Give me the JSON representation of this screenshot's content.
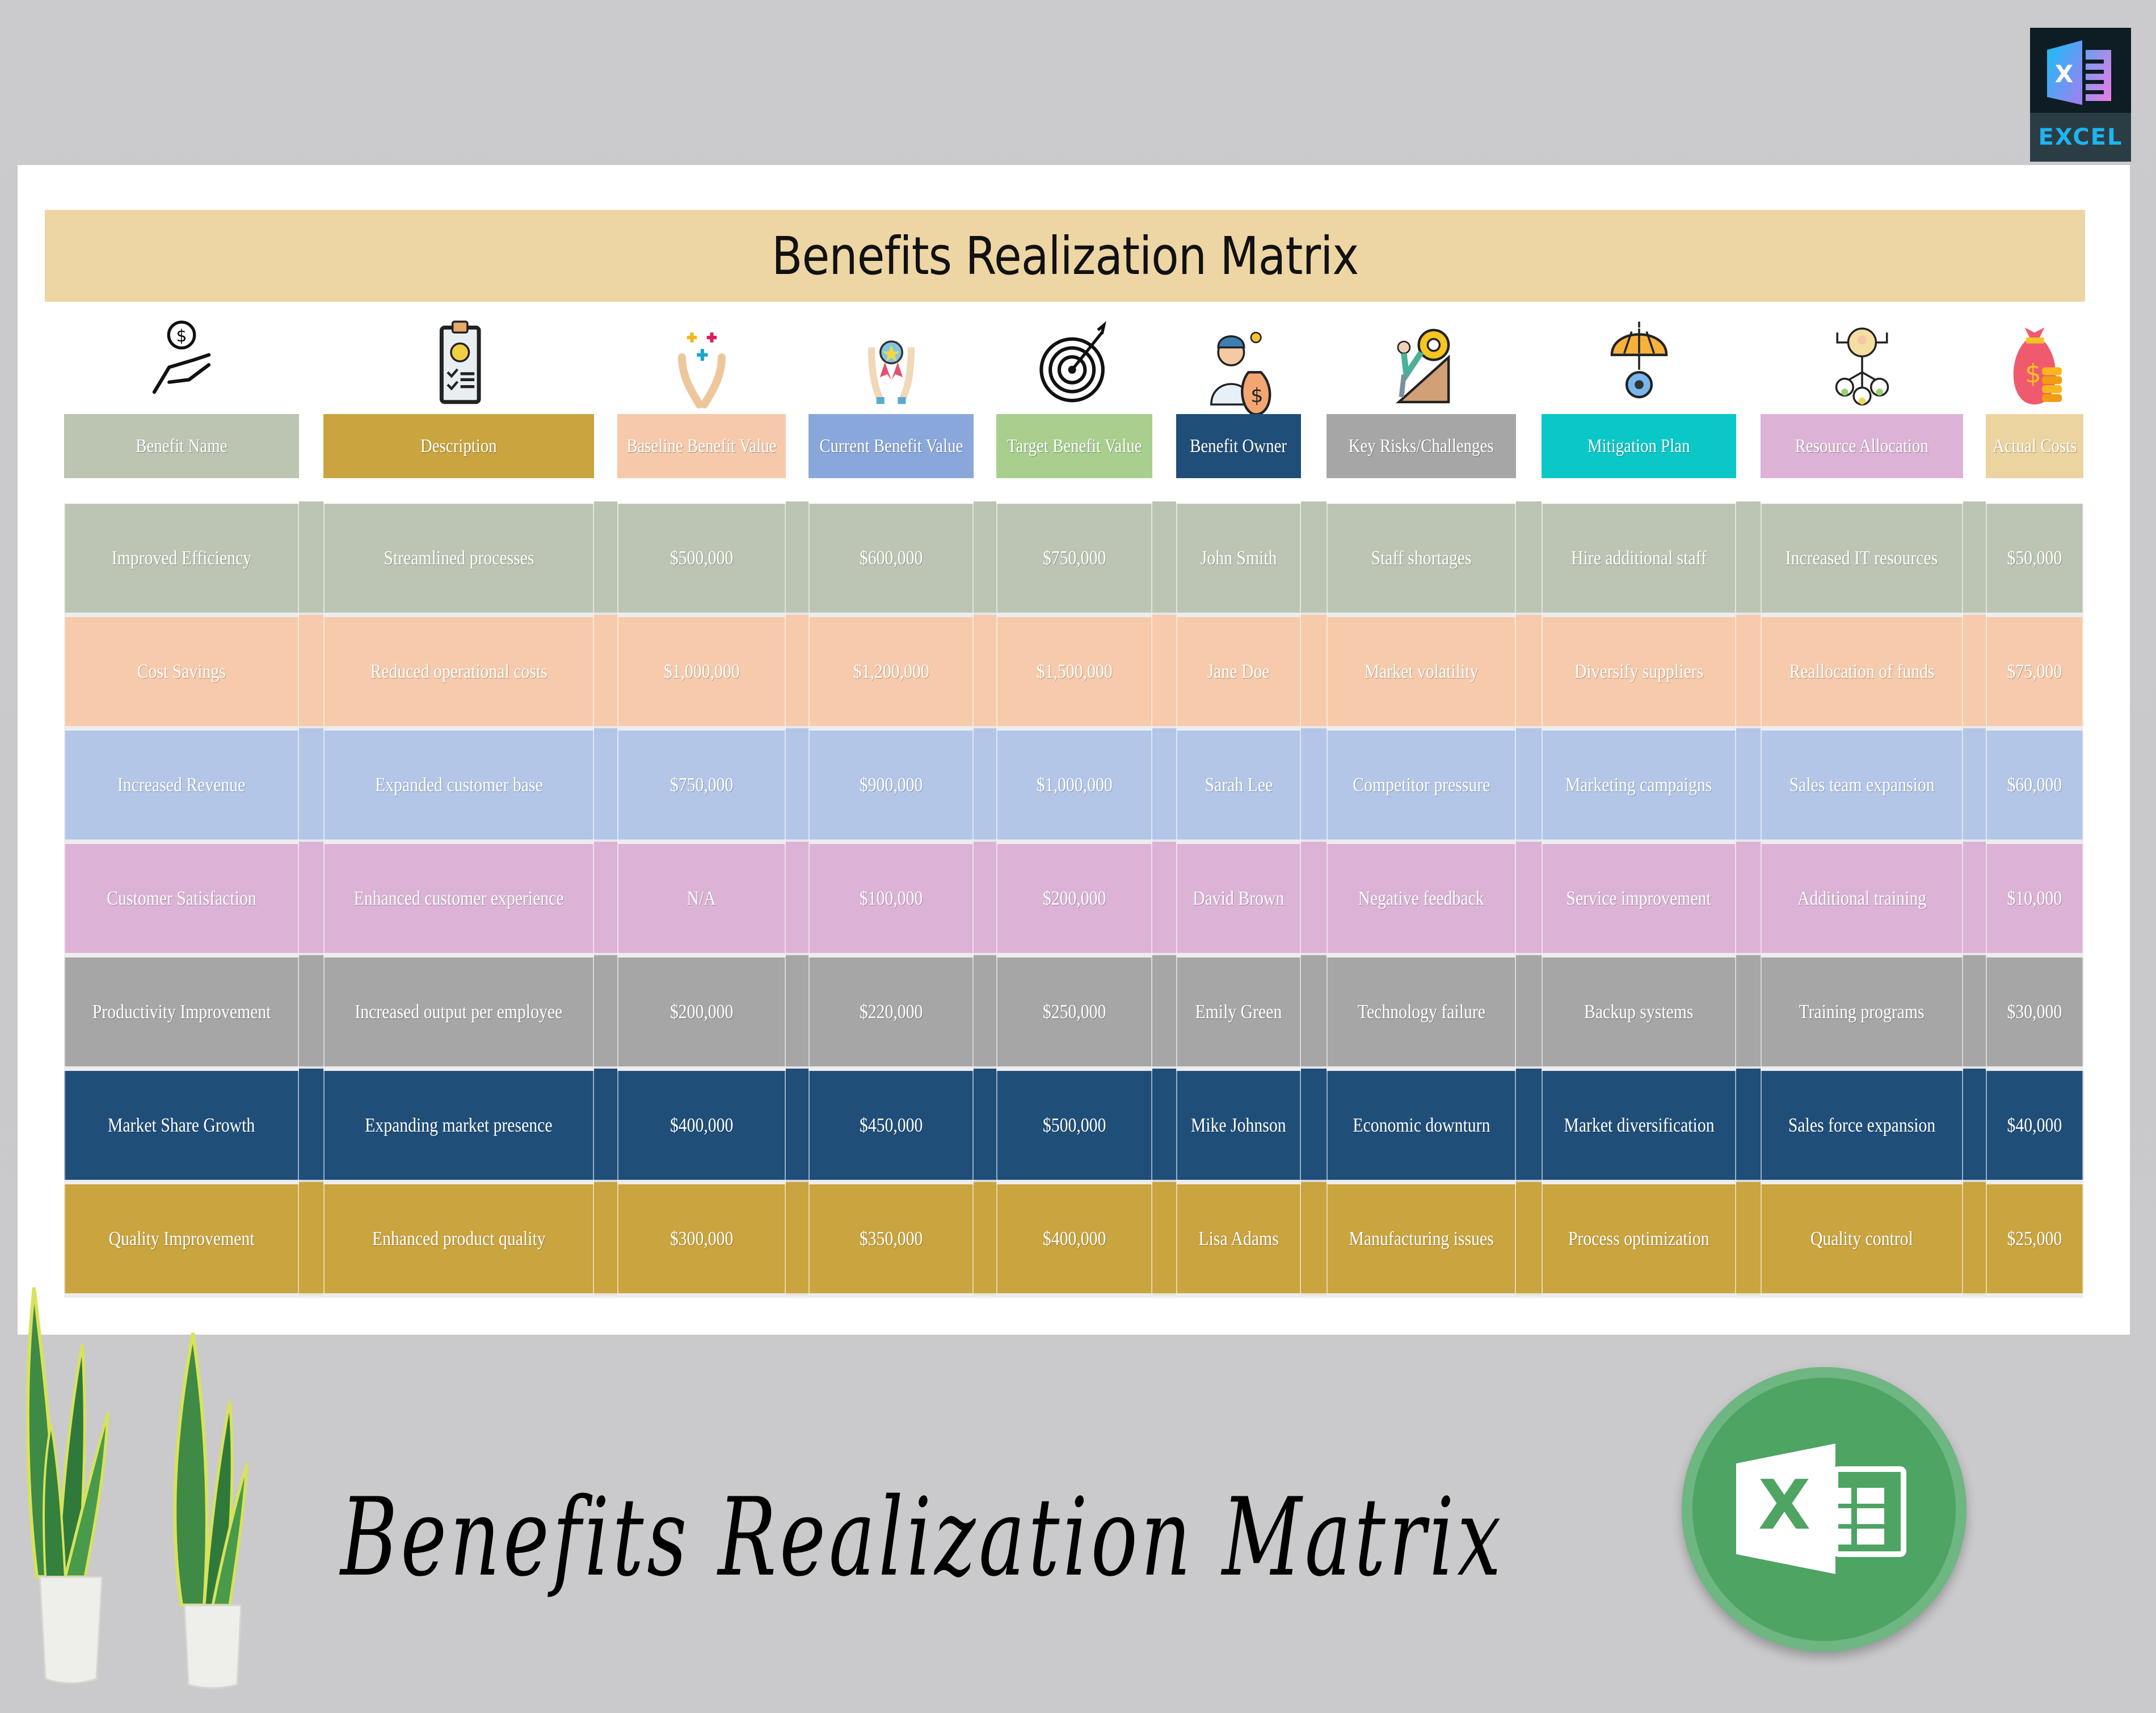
{
  "badge": {
    "label": "EXCEL",
    "icon": "excel-logo-icon",
    "accent": "#1eb4f0"
  },
  "title": "Benefits Realization Matrix",
  "columns": [
    {
      "label": "Benefit Name",
      "icon": "hand-coin-icon",
      "color": "#bcc4b2"
    },
    {
      "label": "Description",
      "icon": "clipboard-checklist-icon",
      "color": "#c9a43f"
    },
    {
      "label": "Baseline Benefit Value",
      "icon": "hands-plus-icon",
      "color": "#f6c9aa"
    },
    {
      "label": "Current Benefit Value",
      "icon": "award-hands-icon",
      "color": "#8aa7db"
    },
    {
      "label": "Target Benefit Value",
      "icon": "target-arrow-icon",
      "color": "#a8cf8e"
    },
    {
      "label": "Benefit Owner",
      "icon": "owner-money-bag-icon",
      "color": "#1f4e79"
    },
    {
      "label": "Key Risks/Challenges",
      "icon": "climber-gear-icon",
      "color": "#a6a6a6"
    },
    {
      "label": "Mitigation Plan",
      "icon": "umbrella-gear-icon",
      "color": "#0ac8c8"
    },
    {
      "label": "Resource Allocation",
      "icon": "team-network-icon",
      "color": "#dcb3d6"
    },
    {
      "label": "Actual Costs",
      "icon": "money-bag-coins-icon",
      "color": "#ecd4a0"
    }
  ],
  "rows": [
    {
      "color": "#bcc5b3",
      "cells": [
        "Improved Efficiency",
        "Streamlined processes",
        "$500,000",
        "$600,000",
        "$750,000",
        "John Smith",
        "Staff shortages",
        "Hire additional staff",
        "Increased IT resources",
        "$50,000"
      ]
    },
    {
      "color": "#f6caab",
      "cells": [
        "Cost Savings",
        "Reduced operational costs",
        "$1,000,000",
        "$1,200,000",
        "$1,500,000",
        "Jane Doe",
        "Market volatility",
        "Diversify suppliers",
        "Reallocation of funds",
        "$75,000"
      ]
    },
    {
      "color": "#b3c6e7",
      "cells": [
        "Increased Revenue",
        "Expanded customer base",
        "$750,000",
        "$900,000",
        "$1,000,000",
        "Sarah Lee",
        "Competitor pressure",
        "Marketing campaigns",
        "Sales team expansion",
        "$60,000"
      ]
    },
    {
      "color": "#dcb3d6",
      "cells": [
        "Customer Satisfaction",
        "Enhanced customer experience",
        "N/A",
        "$100,000",
        "$200,000",
        "David Brown",
        "Negative feedback",
        "Service improvement",
        "Additional training",
        "$10,000"
      ]
    },
    {
      "color": "#a6a6a6",
      "cells": [
        "Productivity Improvement",
        "Increased output per employee",
        "$200,000",
        "$220,000",
        "$250,000",
        "Emily Green",
        "Technology failure",
        "Backup systems",
        "Training programs",
        "$30,000"
      ]
    },
    {
      "color": "#1f4e79",
      "cells": [
        "Market Share Growth",
        "Expanding market presence",
        "$400,000",
        "$450,000",
        "$500,000",
        "Mike Johnson",
        "Economic downturn",
        "Market diversification",
        "Sales force expansion",
        "$40,000"
      ]
    },
    {
      "color": "#c9a43f",
      "cells": [
        "Quality Improvement",
        "Enhanced product quality",
        "$300,000",
        "$350,000",
        "$400,000",
        "Lisa Adams",
        "Manufacturing issues",
        "Process optimization",
        "Quality control",
        "$25,000"
      ]
    }
  ],
  "footer": {
    "script_title": "Benefits Realization Matrix",
    "logo": "excel-circle-logo-icon",
    "decor": "potted-snake-plants"
  }
}
